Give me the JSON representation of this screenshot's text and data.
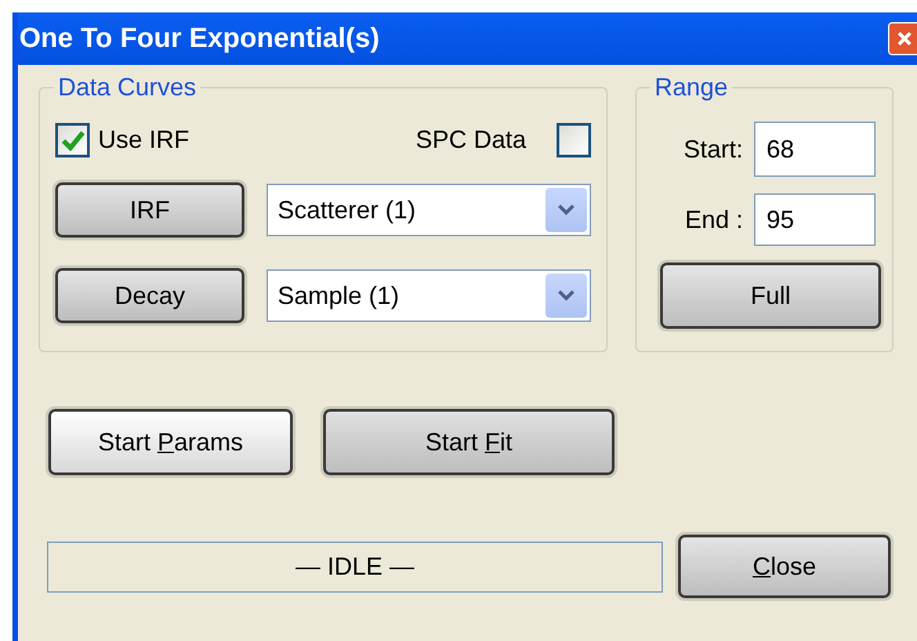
{
  "window": {
    "title": "One To Four Exponential(s)"
  },
  "data_curves": {
    "title": "Data Curves",
    "use_irf": {
      "label": "Use IRF",
      "checked": true
    },
    "spc_data": {
      "label": "SPC Data",
      "checked": false
    },
    "rows": [
      {
        "button": "IRF",
        "value": "Scatterer (1)"
      },
      {
        "button": "Decay",
        "value": "Sample (1)"
      }
    ]
  },
  "range": {
    "title": "Range",
    "start_label": "Start:",
    "start": "68",
    "end_label": "End :",
    "end": "95",
    "full_button": "Full"
  },
  "actions": [
    {
      "label": "Start ",
      "mnemonic": "P",
      "label_rest": "arams",
      "focused": true
    },
    {
      "label": "Start ",
      "mnemonic": "F",
      "label_rest": "it",
      "focused": false
    }
  ],
  "status": "— IDLE —",
  "close_button": {
    "mnemonic": "C",
    "label_rest": "lose"
  }
}
